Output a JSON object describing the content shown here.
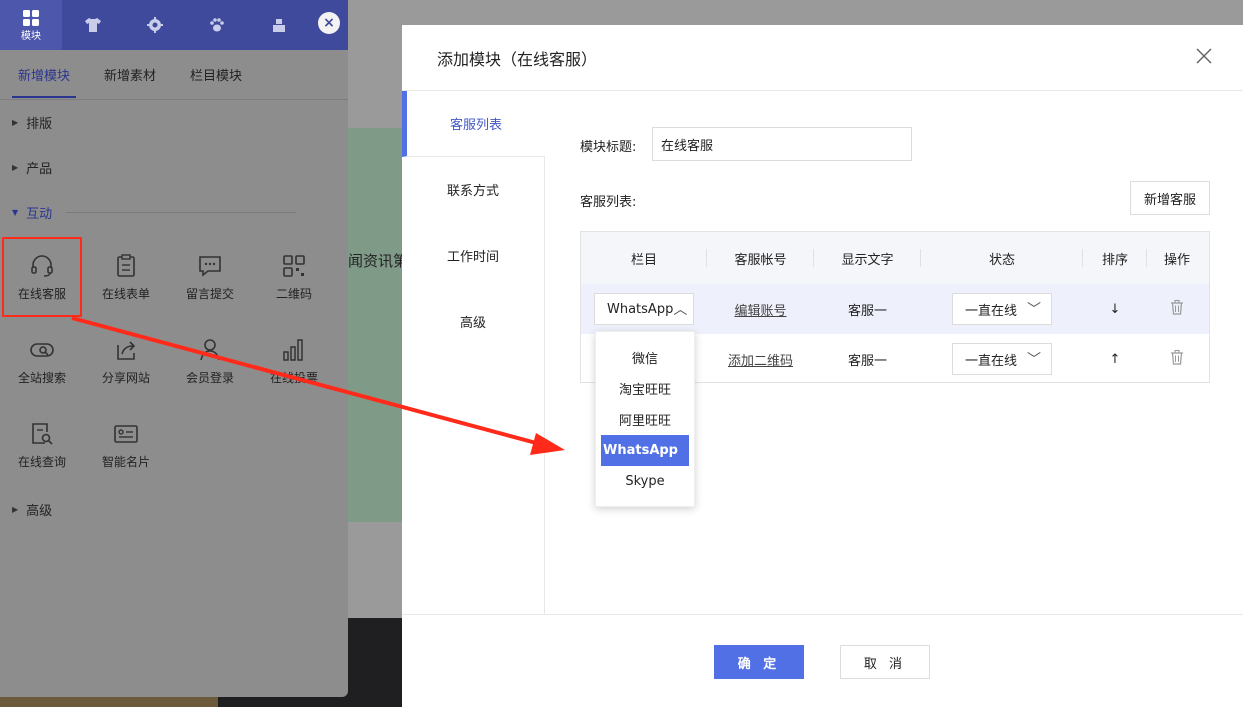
{
  "background": {
    "partial_text": "闻资讯第"
  },
  "left_panel": {
    "topbar": {
      "active_label": "模块",
      "icons": [
        "grid-icon",
        "shirt-icon",
        "gear-icon",
        "paw-icon",
        "layers-icon"
      ],
      "close_symbol": "×"
    },
    "subtabs": [
      "新增模块",
      "新增素材",
      "栏目模块"
    ],
    "sections": {
      "layout": "排版",
      "product": "产品",
      "interact": "互动",
      "advanced": "高级"
    },
    "modules": [
      {
        "label": "在线客服",
        "icon": "headset-icon"
      },
      {
        "label": "在线表单",
        "icon": "clipboard-icon"
      },
      {
        "label": "留言提交",
        "icon": "message-icon"
      },
      {
        "label": "二维码",
        "icon": "qrcode-icon"
      },
      {
        "label": "全站搜索",
        "icon": "search-icon"
      },
      {
        "label": "分享网站",
        "icon": "share-icon"
      },
      {
        "label": "会员登录",
        "icon": "user-icon"
      },
      {
        "label": "在线投票",
        "icon": "bar-chart-icon"
      },
      {
        "label": "在线查询",
        "icon": "doc-search-icon"
      },
      {
        "label": "智能名片",
        "icon": "card-icon"
      }
    ]
  },
  "modal": {
    "title": "添加模块（在线客服）",
    "sidebar": [
      "客服列表",
      "联系方式",
      "工作时间",
      "高级"
    ],
    "module_title_label": "模块标题:",
    "module_title_value": "在线客服",
    "service_list_label": "客服列表:",
    "add_service_button": "新增客服",
    "table": {
      "headers": [
        "栏目",
        "客服帐号",
        "显示文字",
        "状态",
        "排序",
        "操作"
      ],
      "rows": [
        {
          "column": "WhatsApp",
          "account": "编辑账号",
          "text": "客服一",
          "status": "一直在线",
          "sort": "↓"
        },
        {
          "column": "",
          "account": "添加二维码",
          "text": "客服一",
          "status": "一直在线",
          "sort": "↑"
        }
      ]
    },
    "dropdown_options": [
      "微信",
      "淘宝旺旺",
      "阿里旺旺",
      "WhatsApp",
      "Skype"
    ],
    "dropdown_selected": "WhatsApp",
    "confirm_button": "确 定",
    "cancel_button": "取 消"
  },
  "colors": {
    "accent": "#5170e6",
    "topbar": "#404a9d",
    "annotation": "#ff2a1a"
  }
}
